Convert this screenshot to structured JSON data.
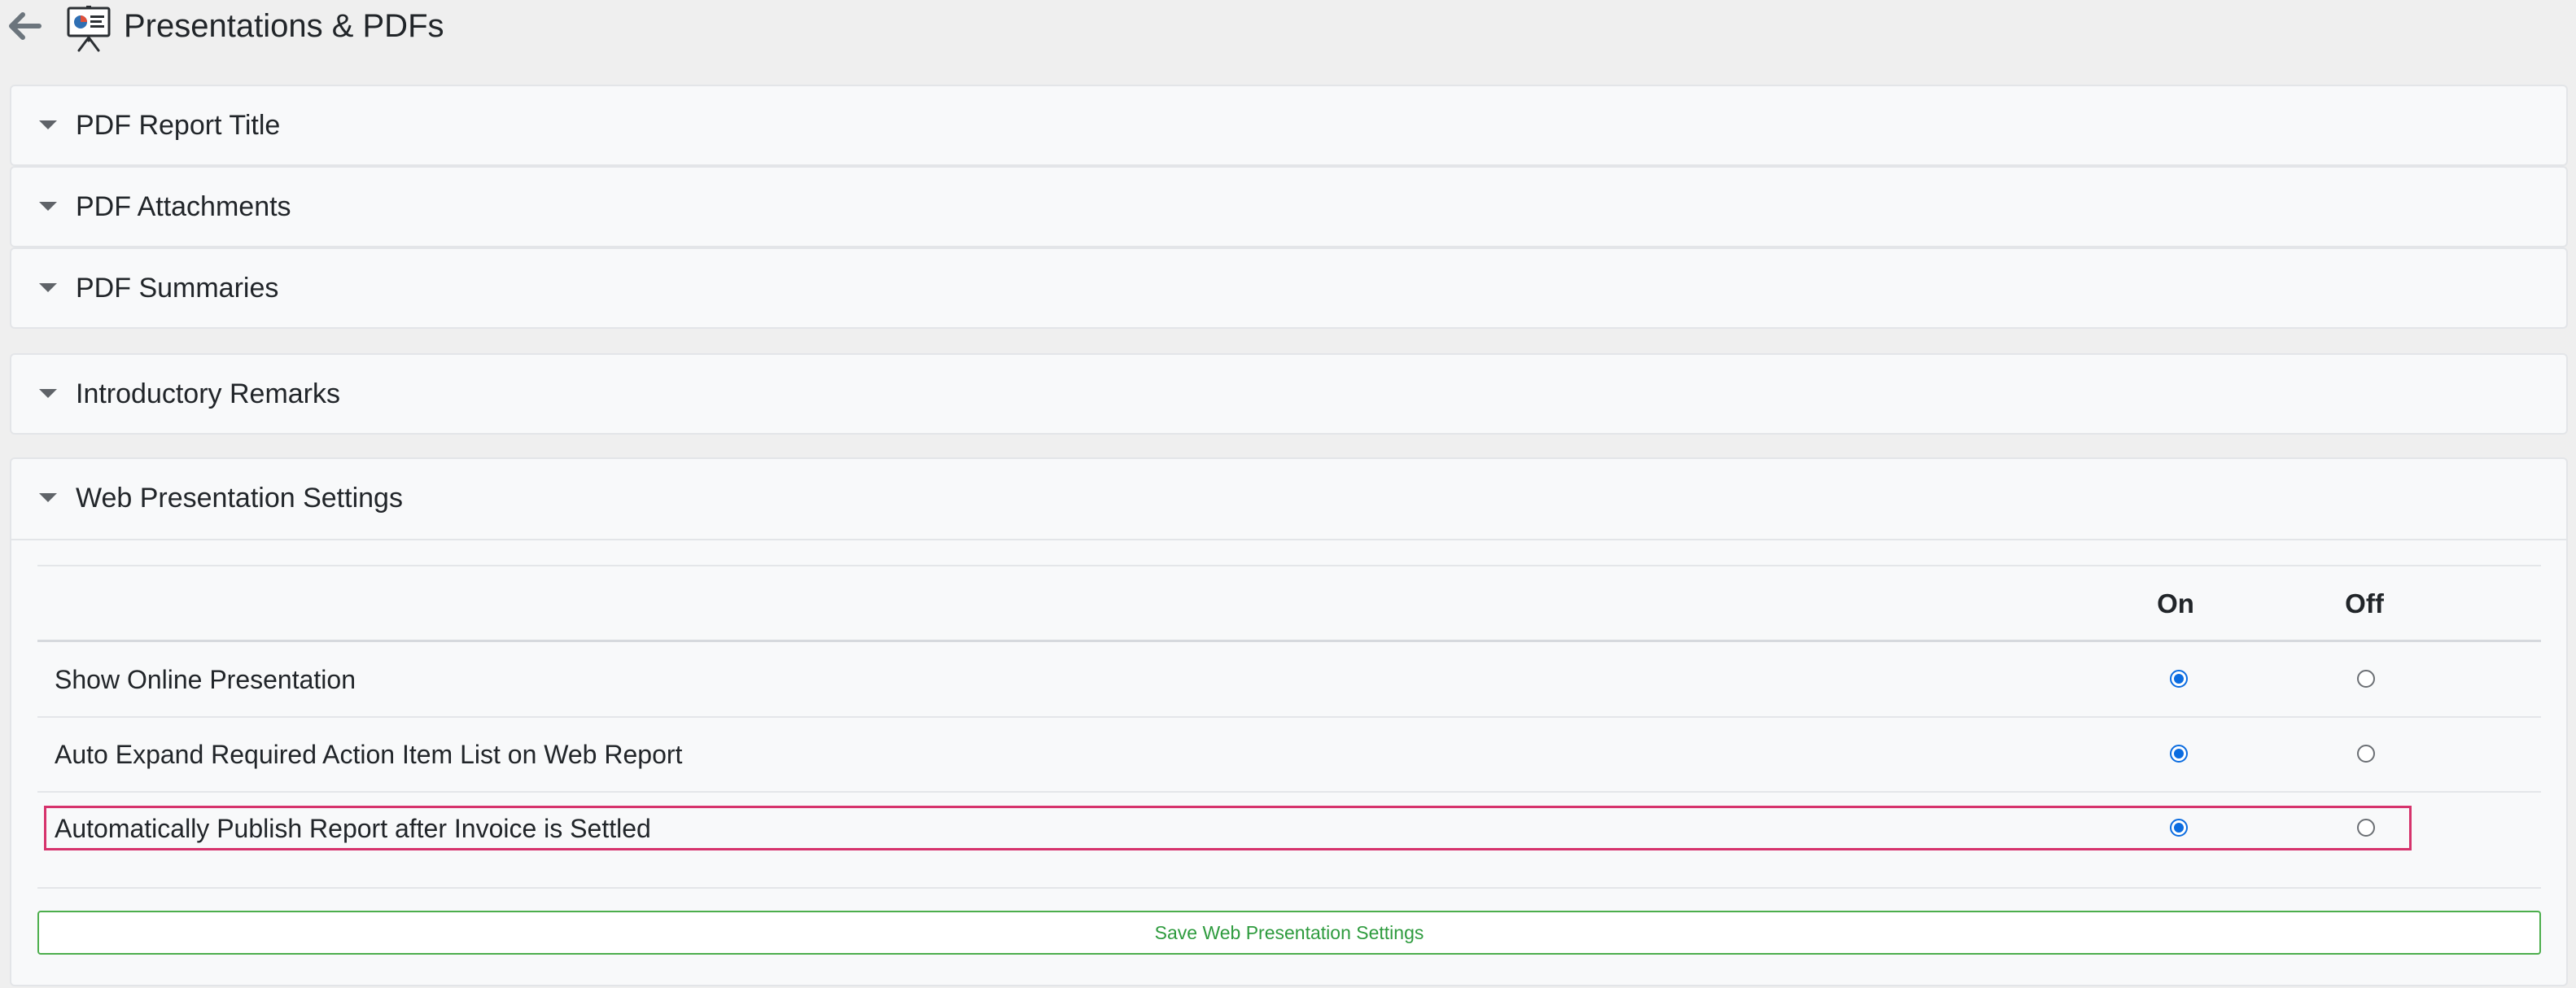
{
  "header": {
    "title": "Presentations & PDFs",
    "back_icon": "arrow-left-icon",
    "app_icon": "presentation-board-icon"
  },
  "panels": [
    {
      "title": "PDF Report Title",
      "expanded": false
    },
    {
      "title": "PDF Attachments",
      "expanded": false
    },
    {
      "title": "PDF Summaries",
      "expanded": false
    },
    {
      "title": "Introductory Remarks",
      "expanded": false
    },
    {
      "title": "Web Presentation Settings",
      "expanded": true
    }
  ],
  "web_settings": {
    "columns": {
      "on": "On",
      "off": "Off"
    },
    "rows": [
      {
        "label": "Show Online Presentation",
        "value": "on"
      },
      {
        "label": "Auto Expand Required Action Item List on Web Report",
        "value": "on"
      },
      {
        "label": "Automatically Publish Report after Invoice is Settled",
        "value": "on",
        "highlighted": true
      }
    ],
    "save_label": "Save Web Presentation Settings"
  },
  "colors": {
    "background": "#efefef",
    "panel": "#f8f9fa",
    "radio_accent": "#0b6ce0",
    "highlight": "#d6336c",
    "save_green": "#2e9b3e"
  }
}
